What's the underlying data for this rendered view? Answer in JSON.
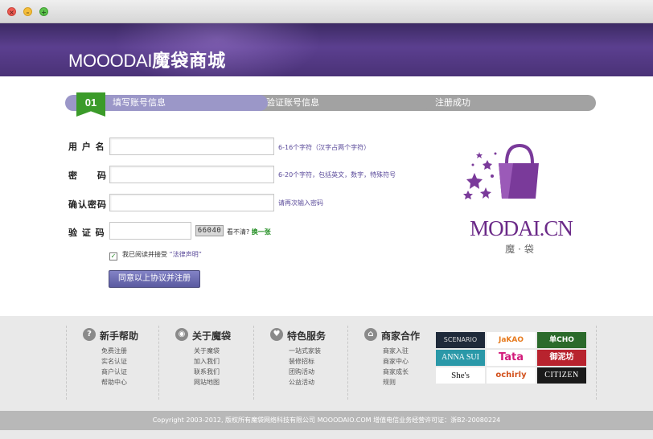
{
  "window": {
    "close_glyph": "×",
    "min_glyph": "–",
    "max_glyph": "+"
  },
  "header": {
    "logo_latin": "MOOODAI",
    "logo_cn": "魔袋商城"
  },
  "steps": [
    {
      "number": "01",
      "label": "填写账号信息"
    },
    {
      "label": "验证账号信息"
    },
    {
      "label": "注册成功"
    }
  ],
  "form": {
    "username": {
      "label": "用 户 名",
      "value": "",
      "hint": "6-16个字符（汉字占两个字符）"
    },
    "password": {
      "label": "密　　码",
      "value": "",
      "hint": "6-20个字符，包括英文，数字，特殊符号"
    },
    "confirm": {
      "label": "确认密码",
      "value": "",
      "hint": "请再次输入密码"
    },
    "captcha": {
      "label": "验 证 码",
      "value": "",
      "image_text": "66040",
      "unclear_text": "看不清?",
      "refresh_text": "换一张"
    },
    "agreement": {
      "check": "✓",
      "text": "我已阅读并接受",
      "link": "“法律声明”"
    },
    "submit_label": "同意以上协议并注册"
  },
  "brand": {
    "name": "MODAI.CN",
    "sub": "魔·袋",
    "accent": "#7a3a9a"
  },
  "footer": {
    "columns": [
      {
        "icon": "?",
        "title": "新手帮助",
        "items": [
          "免费注册",
          "实名认证",
          "商户认证",
          "帮助中心"
        ]
      },
      {
        "icon": "◉",
        "title": "关于魔袋",
        "items": [
          "关于魔袋",
          "加入我们",
          "联系我们",
          "网站地图"
        ]
      },
      {
        "icon": "♥",
        "title": "特色服务",
        "items": [
          "一站式家装",
          "装修招标",
          "团购活动",
          "公益活动"
        ]
      },
      {
        "icon": "⌂",
        "title": "商家合作",
        "items": [
          "商家入驻",
          "商家中心",
          "商家成长",
          "规则"
        ]
      }
    ],
    "brands": [
      "SCENARIO",
      "JaKAO",
      "单CHO",
      "ANNA SUI",
      "Tata",
      "御泥坊",
      "She's",
      "ochirly",
      "CITIZEN"
    ]
  },
  "copyright": "Copyright 2003-2012, 版权所有魔袋网络科技有限公司 MOOODAIO.COM   增值电信业务经营许可证：浙B2-20080224"
}
